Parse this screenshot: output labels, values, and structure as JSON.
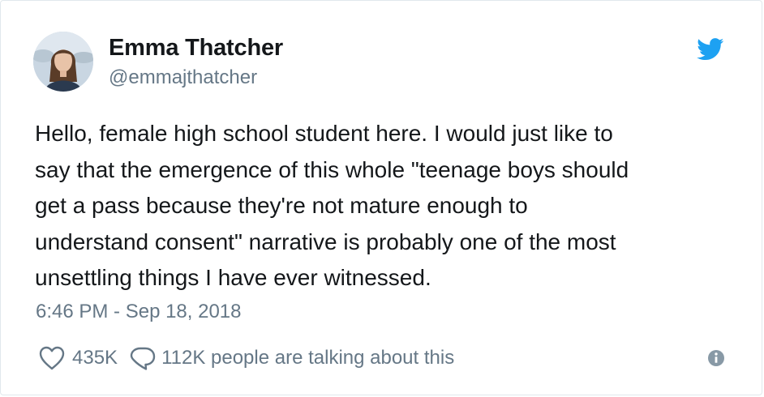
{
  "tweet": {
    "author": {
      "display_name": "Emma Thatcher",
      "handle": "@emmajthatcher"
    },
    "brand_icon": "twitter-bird-icon",
    "text_lines": [
      "Hello, female high school student here. I would just like to",
      "say that the emergence of this whole \"teenage boys should",
      "get a pass because they're not mature enough to",
      "understand consent\" narrative is probably one of the most",
      "unsettling things I have ever witnessed."
    ],
    "timestamp": "6:46 PM - Sep 18, 2018",
    "likes": "435K",
    "talking": "112K people are talking about this"
  },
  "colors": {
    "text_primary": "#14171a",
    "text_secondary": "#657786",
    "brand_blue": "#1da1f2",
    "border": "#e1e8ed"
  },
  "icons": {
    "like": "heart-outline-icon",
    "reply": "speech-bubble-icon",
    "info": "info-circle-icon"
  }
}
